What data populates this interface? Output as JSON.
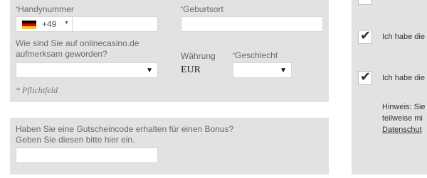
{
  "form": {
    "phone_label_req": "*",
    "phone_label": "Handynummer",
    "phone_prefix": "+49",
    "phone_value": "",
    "birth_label_req": "*",
    "birth_label": "Geburtsort",
    "birth_value": "",
    "source_label_line1": "Wie sind Sie auf onlinecasino.de",
    "source_label_line2": "aufmerksam geworden?",
    "source_selected": "",
    "currency_label": "Währung",
    "currency_value": "EUR",
    "gender_label_req": "*",
    "gender_label": "Geschlecht",
    "gender_selected": "",
    "required_note": "* Pflichtfeld"
  },
  "bonus": {
    "line1": "Haben Sie eine Gutscheincode erhalten für einen Bonus?",
    "line2": "Geben Sie diesen bitte hier ein.",
    "code_value": ""
  },
  "right": {
    "consent1": "Ich habe die",
    "consent2": "Ich habe die",
    "hint_line1": "Hinweis: Sie",
    "hint_line2": "teilweise mi",
    "hint_link": "Datenschut"
  },
  "colors": {
    "panel_bg": "#e2e2e2",
    "flag_black": "#000000",
    "flag_red": "#dd0000",
    "flag_gold": "#ffce00"
  },
  "icons": {
    "dropdown": "triangle-down",
    "check": "checkmark"
  }
}
